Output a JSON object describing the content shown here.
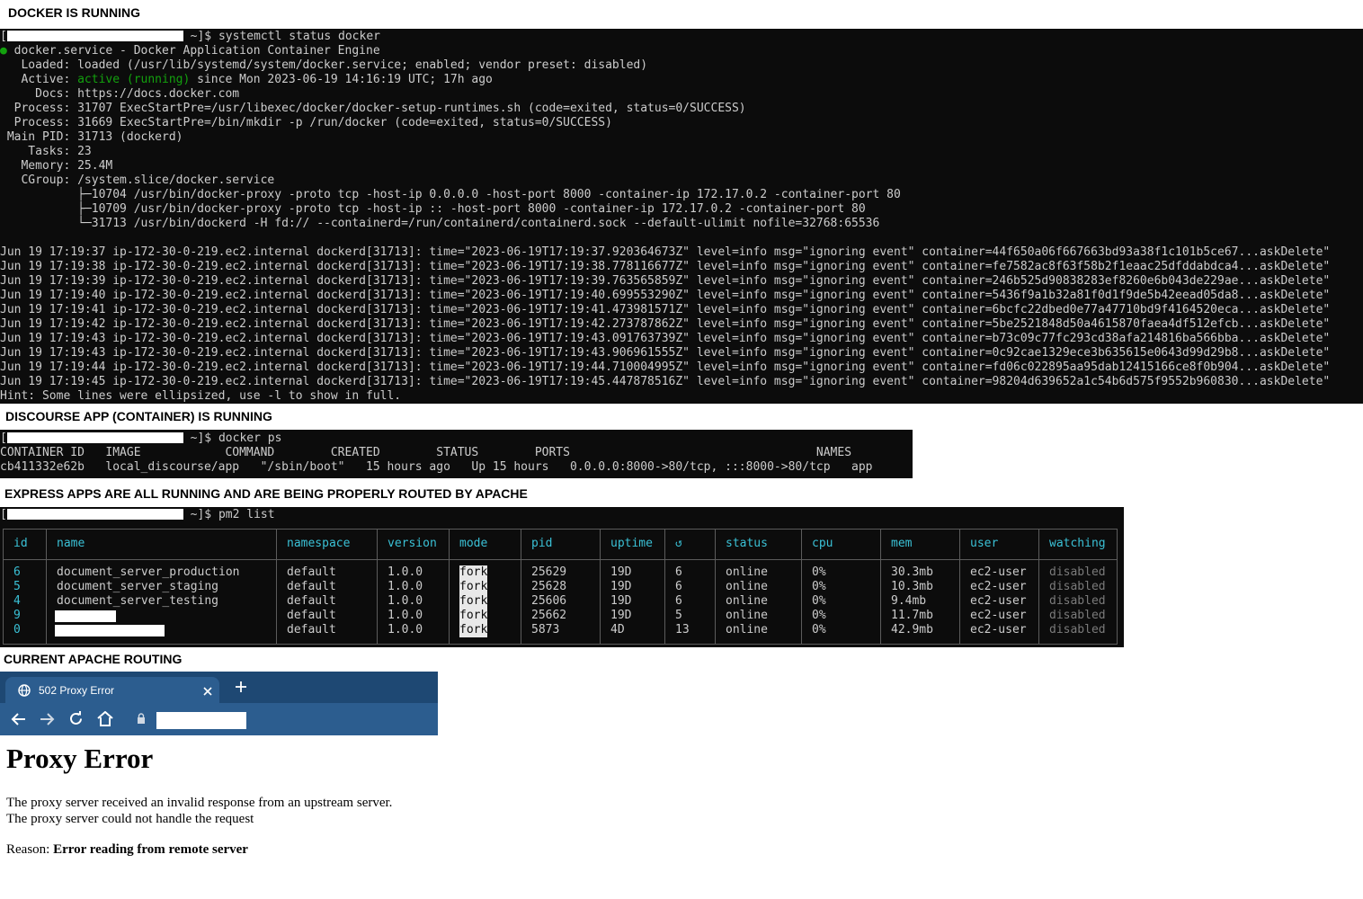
{
  "headings": {
    "docker": "DOCKER IS RUNNING",
    "discourse": "DISCOURSE APP (CONTAINER) IS RUNNING",
    "express": "EXPRESS APPS ARE ALL RUNNING AND ARE BEING PROPERLY ROUTED BY APACHE",
    "apache": "CURRENT APACHE ROUTING"
  },
  "docker_terminal": {
    "prompt_open": "[",
    "prompt_suffix": " ~]$ systemctl status docker",
    "bullet": "●",
    "service_line": " docker.service - Docker Application Container Engine",
    "loaded": "   Loaded: loaded (/usr/lib/systemd/system/docker.service; enabled; vendor preset: disabled)",
    "active_label": "   Active: ",
    "active_state": "active (running)",
    "active_rest": " since Mon 2023-06-19 14:16:19 UTC; 17h ago",
    "docs": "     Docs: https://docs.docker.com",
    "process1": "  Process: 31707 ExecStartPre=/usr/libexec/docker/docker-setup-runtimes.sh (code=exited, status=0/SUCCESS)",
    "process2": "  Process: 31669 ExecStartPre=/bin/mkdir -p /run/docker (code=exited, status=0/SUCCESS)",
    "main_pid": " Main PID: 31713 (dockerd)",
    "tasks": "    Tasks: 23",
    "memory": "   Memory: 25.4M",
    "cgroup": "   CGroup: /system.slice/docker.service",
    "cgroup_children": [
      "           ├─10704 /usr/bin/docker-proxy -proto tcp -host-ip 0.0.0.0 -host-port 8000 -container-ip 172.17.0.2 -container-port 80",
      "           ├─10709 /usr/bin/docker-proxy -proto tcp -host-ip :: -host-port 8000 -container-ip 172.17.0.2 -container-port 80",
      "           └─31713 /usr/bin/dockerd -H fd:// --containerd=/run/containerd/containerd.sock --default-ulimit nofile=32768:65536"
    ],
    "log_lines": [
      "Jun 19 17:19:37 ip-172-30-0-219.ec2.internal dockerd[31713]: time=\"2023-06-19T17:19:37.920364673Z\" level=info msg=\"ignoring event\" container=44f650a06f667663bd93a38f1c101b5ce67...askDelete\"",
      "Jun 19 17:19:38 ip-172-30-0-219.ec2.internal dockerd[31713]: time=\"2023-06-19T17:19:38.778116677Z\" level=info msg=\"ignoring event\" container=fe7582ac8f63f58b2f1eaac25dfddabdca4...askDelete\"",
      "Jun 19 17:19:39 ip-172-30-0-219.ec2.internal dockerd[31713]: time=\"2023-06-19T17:19:39.763565859Z\" level=info msg=\"ignoring event\" container=246b525d90838283ef8260e6b043de229ae...askDelete\"",
      "Jun 19 17:19:40 ip-172-30-0-219.ec2.internal dockerd[31713]: time=\"2023-06-19T17:19:40.699553290Z\" level=info msg=\"ignoring event\" container=5436f9a1b32a81f0d1f9de5b42eead05da8...askDelete\"",
      "Jun 19 17:19:41 ip-172-30-0-219.ec2.internal dockerd[31713]: time=\"2023-06-19T17:19:41.473981571Z\" level=info msg=\"ignoring event\" container=6bcfc22dbed0e77a47710bd9f4164520eca...askDelete\"",
      "Jun 19 17:19:42 ip-172-30-0-219.ec2.internal dockerd[31713]: time=\"2023-06-19T17:19:42.273787862Z\" level=info msg=\"ignoring event\" container=5be2521848d50a4615870faea4df512efcb...askDelete\"",
      "Jun 19 17:19:43 ip-172-30-0-219.ec2.internal dockerd[31713]: time=\"2023-06-19T17:19:43.091763739Z\" level=info msg=\"ignoring event\" container=b73c09c77fc293cd38afa214816ba566bba...askDelete\"",
      "Jun 19 17:19:43 ip-172-30-0-219.ec2.internal dockerd[31713]: time=\"2023-06-19T17:19:43.906961555Z\" level=info msg=\"ignoring event\" container=0c92cae1329ece3b635615e0643d99d29b8...askDelete\"",
      "Jun 19 17:19:44 ip-172-30-0-219.ec2.internal dockerd[31713]: time=\"2023-06-19T17:19:44.710004995Z\" level=info msg=\"ignoring event\" container=fd06c022895aa95dab12415166ce8f0b904...askDelete\"",
      "Jun 19 17:19:45 ip-172-30-0-219.ec2.internal dockerd[31713]: time=\"2023-06-19T17:19:45.447878516Z\" level=info msg=\"ignoring event\" container=98204d639652a1c54b6d575f9552b960830...askDelete\""
    ],
    "hint": "Hint: Some lines were ellipsized, use -l to show in full."
  },
  "docker_ps": {
    "prompt_open": "[",
    "prompt_suffix": " ~]$ docker ps",
    "header": "CONTAINER ID   IMAGE            COMMAND        CREATED        STATUS        PORTS                                   NAMES",
    "row": "cb411332e62b   local_discourse/app   \"/sbin/boot\"   15 hours ago   Up 15 hours   0.0.0.0:8000->80/tcp, :::8000->80/tcp   app"
  },
  "pm2": {
    "prompt_open": "[",
    "prompt_suffix": " ~]$ pm2 list",
    "columns": [
      "id",
      "name",
      "namespace",
      "version",
      "mode",
      "pid",
      "uptime",
      "↺",
      "status",
      "cpu",
      "mem",
      "user",
      "watching"
    ],
    "rows": [
      {
        "id": "6",
        "name": "document_server_production",
        "namespace": "default",
        "version": "1.0.0",
        "mode": "fork",
        "pid": "25629",
        "uptime": "19D",
        "restarts": "6",
        "status": "online",
        "cpu": "0%",
        "mem": "30.3mb",
        "user": "ec2-user",
        "watching": "disabled"
      },
      {
        "id": "5",
        "name": "document_server_staging",
        "namespace": "default",
        "version": "1.0.0",
        "mode": "fork",
        "pid": "25628",
        "uptime": "19D",
        "restarts": "6",
        "status": "online",
        "cpu": "0%",
        "mem": "10.3mb",
        "user": "ec2-user",
        "watching": "disabled"
      },
      {
        "id": "4",
        "name": "document_server_testing",
        "namespace": "default",
        "version": "1.0.0",
        "mode": "fork",
        "pid": "25606",
        "uptime": "19D",
        "restarts": "6",
        "status": "online",
        "cpu": "0%",
        "mem": "9.4mb",
        "user": "ec2-user",
        "watching": "disabled"
      },
      {
        "id": "9",
        "name": "",
        "namespace": "default",
        "version": "1.0.0",
        "mode": "fork",
        "pid": "25662",
        "uptime": "19D",
        "restarts": "5",
        "status": "online",
        "cpu": "0%",
        "mem": "11.7mb",
        "user": "ec2-user",
        "watching": "disabled"
      },
      {
        "id": "0",
        "name": "",
        "namespace": "default",
        "version": "1.0.0",
        "mode": "fork",
        "pid": "5873",
        "uptime": "4D",
        "restarts": "13",
        "status": "online",
        "cpu": "0%",
        "mem": "42.9mb",
        "user": "ec2-user",
        "watching": "disabled"
      }
    ]
  },
  "browser": {
    "tab_title": "502 Proxy Error",
    "tab_icon": "globe-icon",
    "close_icon": "close-icon",
    "new_tab_icon": "plus-icon",
    "url": ""
  },
  "proxy_error": {
    "title": "Proxy Error",
    "line1": "The proxy server received an invalid response from an upstream server.",
    "line2": "The proxy server could not handle the request",
    "reason_label": "Reason: ",
    "reason": "Error reading from remote server"
  },
  "colors": {
    "terminal_bg": "#0c0c0c",
    "terminal_text": "#cccccc",
    "active_green": "#13a10e",
    "pm2_cyan": "#3ac1d6",
    "browser_frame": "#1e4873",
    "browser_tab": "#2c5d8f"
  }
}
